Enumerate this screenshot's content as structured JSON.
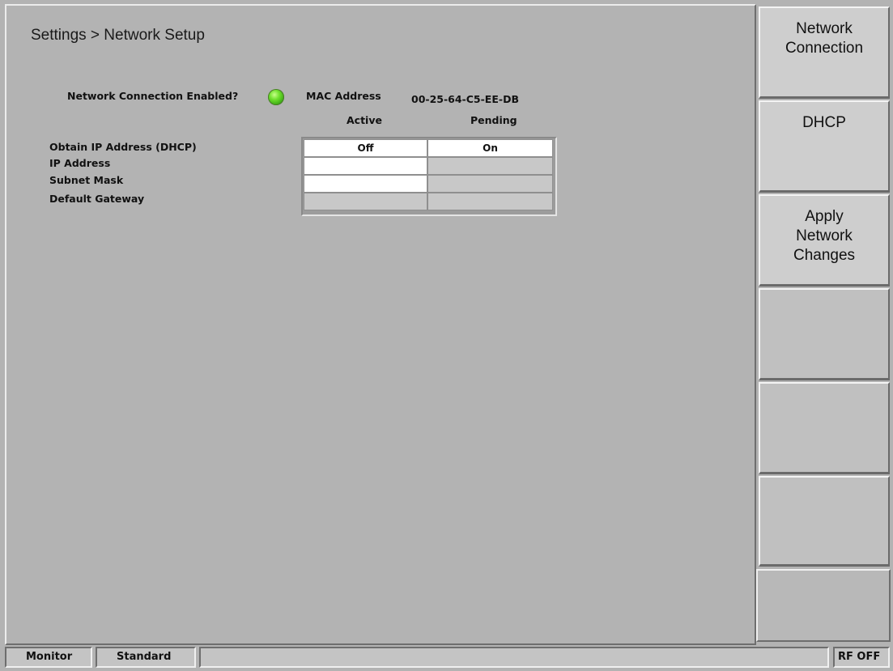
{
  "header": {
    "breadcrumb": "Settings > Network Setup"
  },
  "network": {
    "enabled_label": "Network Connection Enabled?",
    "enabled_state": "on",
    "mac_label": "MAC Address",
    "mac_value": "00-25-64-C5-EE-DB"
  },
  "table": {
    "col_active": "Active",
    "col_pending": "Pending",
    "rows": [
      {
        "label": "Obtain IP Address (DHCP)",
        "active": "Off",
        "pending": "On"
      },
      {
        "label": "IP Address",
        "active": "",
        "pending": ""
      },
      {
        "label": "Subnet Mask",
        "active": "",
        "pending": ""
      },
      {
        "label": "Default Gateway",
        "active": "",
        "pending": ""
      }
    ]
  },
  "softkeys": {
    "network_connection": "Network\nConnection",
    "dhcp": "DHCP",
    "apply": "Apply\nNetwork\nChanges"
  },
  "statusbar": {
    "mode": "Monitor",
    "standard": "Standard",
    "rf_state": "RF OFF"
  },
  "colors": {
    "led_on": "#6ee02c",
    "background": "#b3b3b3"
  }
}
